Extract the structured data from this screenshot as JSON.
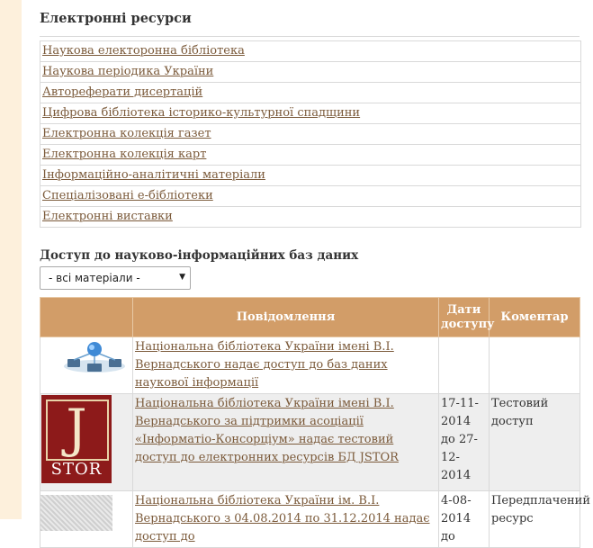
{
  "resources": {
    "title": "Електронні ресурси",
    "items": [
      "Наукова електоронна бібліотека",
      "Наукова періодика України",
      "Автореферати дисертацій",
      "Цифрова бібліотека історико-культурної спадщини",
      "Електронна колекція газет",
      "Електронна колекція карт",
      "Інформаційно-аналітичні матеріали",
      "Спеціалізовані е-бібліотеки",
      "Електронні виставки"
    ]
  },
  "databases": {
    "title": "Доступ до науково-інформаційних баз даних",
    "filter_value": "- всі матеріали -",
    "columns": {
      "message": "Повідомлення",
      "dates": "Дати доступу",
      "comment": "Коментар"
    },
    "rows": [
      {
        "thumb": "network-icon",
        "message": "Національна бібліотека України імені В.І. Вернадського надає доступ до баз даних наукової інформації",
        "dates": "",
        "comment": ""
      },
      {
        "thumb": "jstor-logo",
        "logo_letter": "J",
        "logo_word": "STOR",
        "message": "Національна бібліотека України імені В.І. Вернадського за підтримки асоціації «Інформатіо-Консорціум» надає тестовий доступ до електронних ресурсів БД JSTOR",
        "dates": "17-11-2014 до 27-12-2014",
        "comment": "Тестовий доступ"
      },
      {
        "thumb": "document-thumbnail",
        "message": "Національна бібліотека України ім. В.І. Вернадського з 04.08.2014 по 31.12.2014 надає доступ до",
        "dates": "4-08-2014 до",
        "comment": "Передплачений ресурс"
      }
    ]
  }
}
